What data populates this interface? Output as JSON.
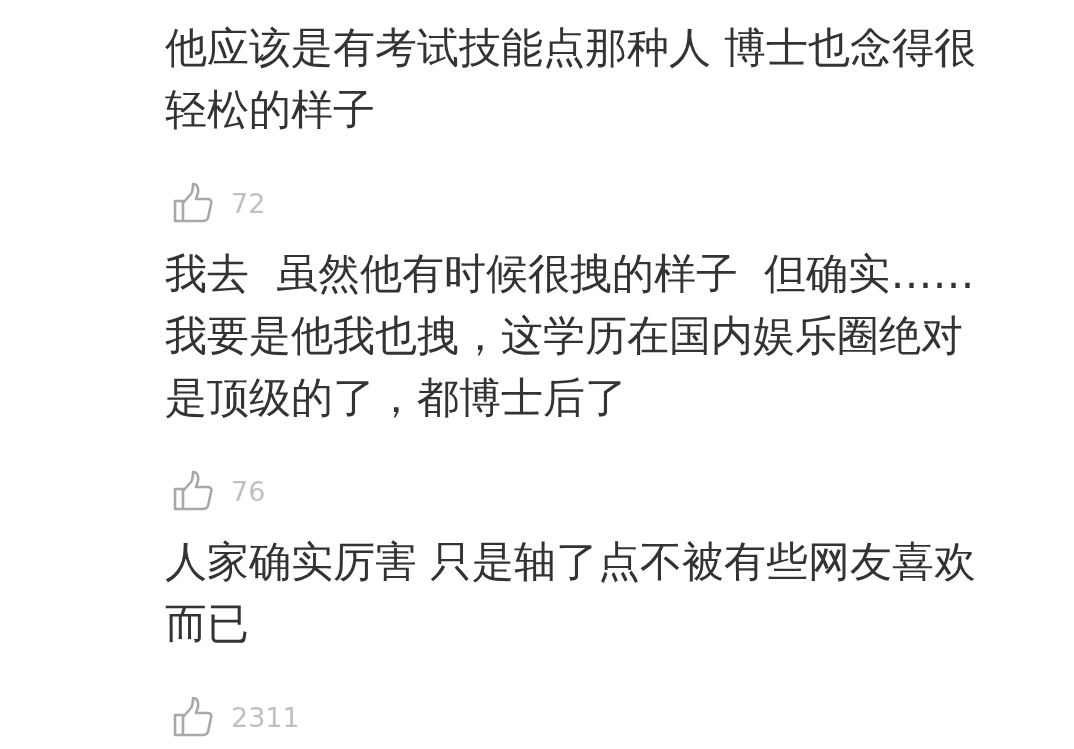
{
  "comments": [
    {
      "text": "他应该是有考试技能点那种人 博士也念得很轻松的样子",
      "likes": "72"
    },
    {
      "text": "我去  虽然他有时候很拽的样子  但确实……\n我要是他我也拽，这学历在国内娱乐圈绝对是顶级的了，都博士后了",
      "likes": "76"
    },
    {
      "text": "人家确实厉害 只是轴了点不被有些网友喜欢而已",
      "likes": "2311"
    }
  ]
}
